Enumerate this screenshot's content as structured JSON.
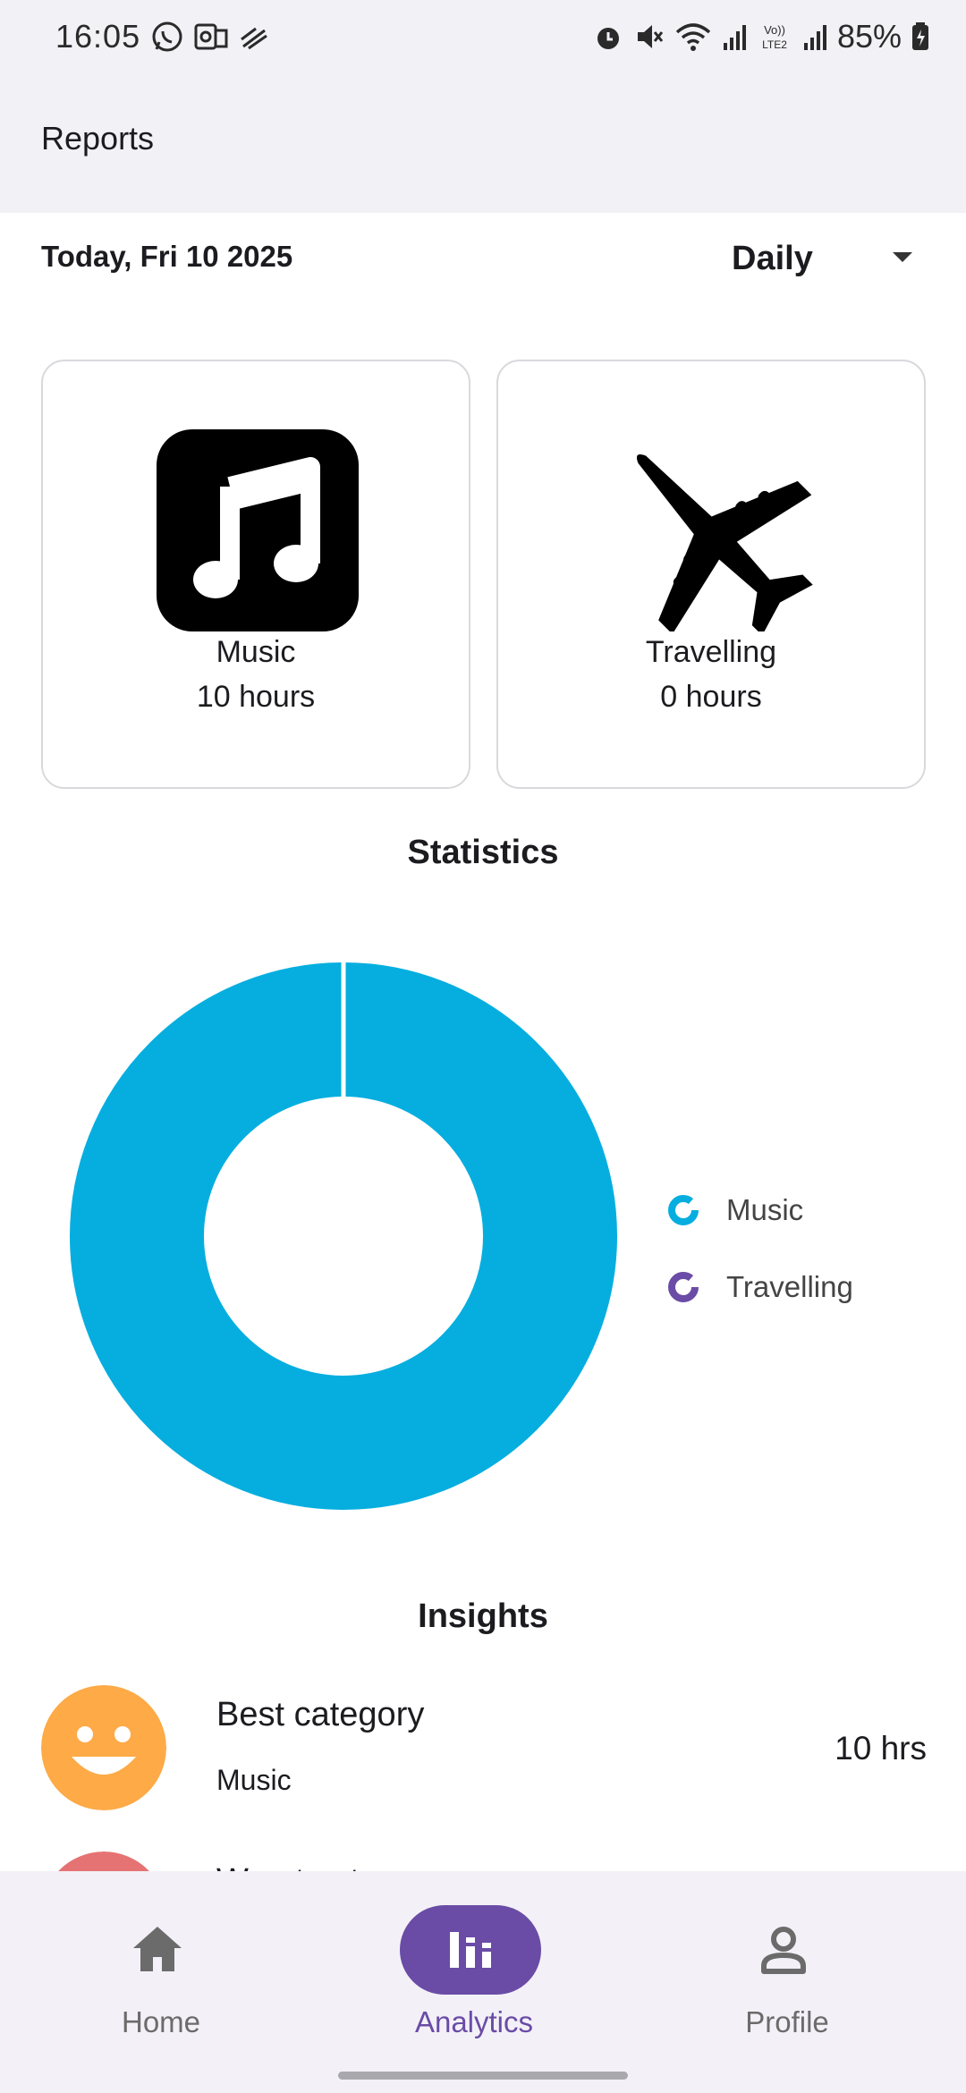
{
  "status_bar": {
    "time": "16:05",
    "battery": "85%",
    "left_icons": [
      "whatsapp-icon",
      "outlook-icon",
      "signal-strength-alt-icon"
    ],
    "right_icons": [
      "alarm-icon",
      "mute-icon",
      "wifi-icon",
      "cell-signal-icon",
      "volte-lte2-icon",
      "cell-signal-icon",
      "battery-charging-icon"
    ]
  },
  "app_bar": {
    "title": "Reports"
  },
  "filter": {
    "date_label": "Today, Fri 10 2025",
    "period": "Daily"
  },
  "categories": [
    {
      "name": "Music",
      "hours": "10 hours",
      "icon": "music-note-icon"
    },
    {
      "name": "Travelling",
      "hours": "0 hours",
      "icon": "airplane-icon"
    }
  ],
  "statistics": {
    "title": "Statistics",
    "legend": [
      {
        "label": "Music",
        "color": "#06aedf"
      },
      {
        "label": "Travelling",
        "color": "#6a4ca6"
      }
    ]
  },
  "chart_data": {
    "type": "pie",
    "donut": true,
    "categories": [
      "Music",
      "Travelling"
    ],
    "values": [
      10,
      0
    ],
    "colors": [
      "#06aedf",
      "#6a4ca6"
    ],
    "legend": "right"
  },
  "insights": {
    "title": "Insights",
    "items": [
      {
        "title": "Best category",
        "subtitle": "Music",
        "value": "10 hrs",
        "avatar_color": "#fdaa47",
        "avatar_icon": "smiley-face-icon"
      },
      {
        "title": "Worst category",
        "avatar_color": "#e57373"
      }
    ]
  },
  "bottom_nav": {
    "items": [
      {
        "label": "Home",
        "icon": "home-icon",
        "active": false
      },
      {
        "label": "Analytics",
        "icon": "bar-chart-icon",
        "active": true
      },
      {
        "label": "Profile",
        "icon": "person-icon",
        "active": false
      }
    ]
  },
  "colors": {
    "accent": "#6a4ca6",
    "chart_cyan": "#06aedf",
    "app_bar_bg": "#f1f1f6"
  }
}
